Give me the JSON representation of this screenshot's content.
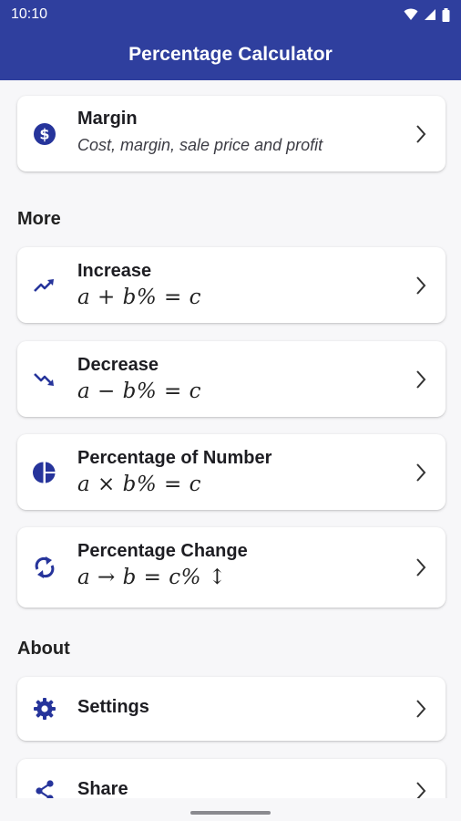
{
  "status_bar": {
    "time": "10:10"
  },
  "app_bar": {
    "title": "Percentage Calculator"
  },
  "margin_card": {
    "title": "Margin",
    "subtitle": "Cost, margin, sale price and profit"
  },
  "sections": {
    "more": "More",
    "about": "About"
  },
  "calculators": [
    {
      "title": "Increase",
      "formula": "a + b% = c",
      "icon": "trending-up-icon"
    },
    {
      "title": "Decrease",
      "formula": "a − b% = c",
      "icon": "trending-down-icon"
    },
    {
      "title": "Percentage of Number",
      "formula": "a × b% = c",
      "icon": "pie-chart-icon"
    },
    {
      "title": "Percentage Change",
      "formula": "a → b = c% ↕",
      "icon": "sync-icon"
    }
  ],
  "about_items": [
    {
      "title": "Settings",
      "icon": "gear-icon"
    },
    {
      "title": "Share",
      "icon": "share-icon"
    }
  ],
  "colors": {
    "primary": "#2F3F9E",
    "icon": "#26349B",
    "background": "#F7F7F9"
  }
}
